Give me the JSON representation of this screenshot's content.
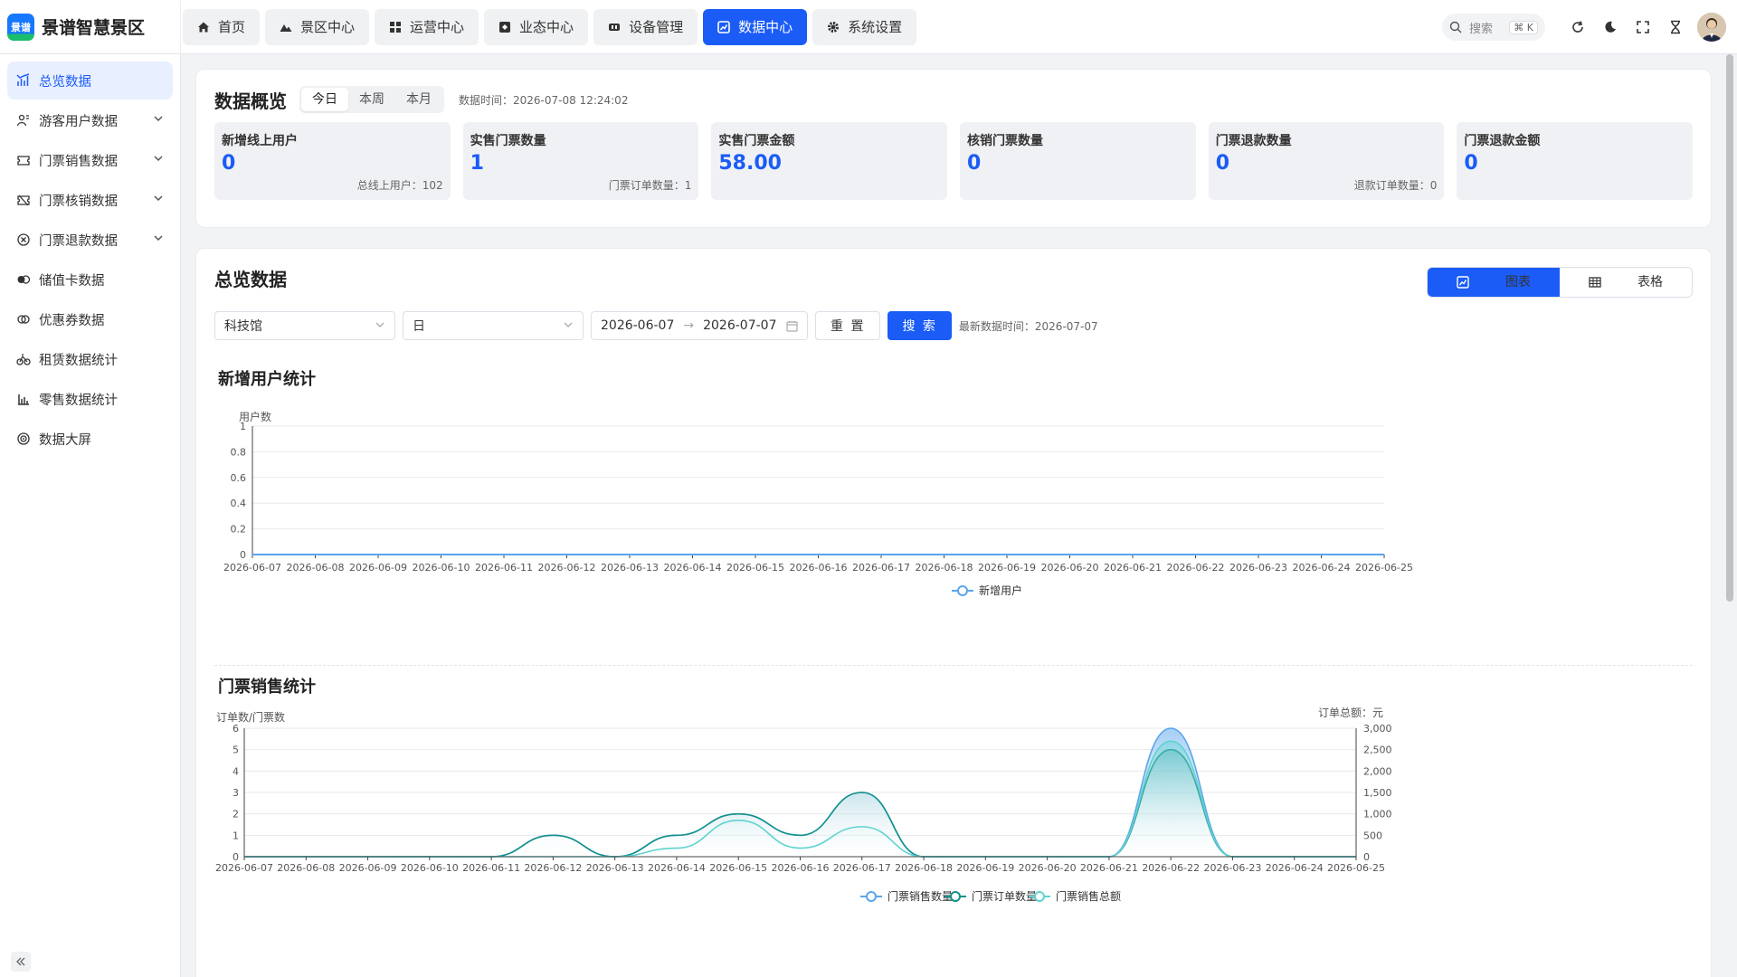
{
  "app": {
    "title": "景谱智慧景区",
    "logo_text": "景谱"
  },
  "topnav": [
    {
      "label": "首页",
      "icon": "home-icon",
      "active": false
    },
    {
      "label": "景区中心",
      "icon": "mountain-icon",
      "active": false
    },
    {
      "label": "运营中心",
      "icon": "grid-icon",
      "active": false
    },
    {
      "label": "业态中心",
      "icon": "store-icon",
      "active": false
    },
    {
      "label": "设备管理",
      "icon": "device-icon",
      "active": false
    },
    {
      "label": "数据中心",
      "icon": "chart-icon",
      "active": true
    },
    {
      "label": "系统设置",
      "icon": "gear-icon",
      "active": false
    }
  ],
  "header": {
    "search_placeholder": "搜索",
    "search_shortcut": "⌘ K"
  },
  "sidebar": {
    "items": [
      {
        "label": "总览数据",
        "icon": "bar-chart-icon",
        "active": true,
        "expandable": false
      },
      {
        "label": "游客用户数据",
        "icon": "users-icon",
        "active": false,
        "expandable": true
      },
      {
        "label": "门票销售数据",
        "icon": "ticket-icon",
        "active": false,
        "expandable": true
      },
      {
        "label": "门票核销数据",
        "icon": "ticket-check-icon",
        "active": false,
        "expandable": true
      },
      {
        "label": "门票退款数据",
        "icon": "refund-icon",
        "active": false,
        "expandable": true
      },
      {
        "label": "储值卡数据",
        "icon": "card-icon",
        "active": false,
        "expandable": false
      },
      {
        "label": "优惠券数据",
        "icon": "coupon-icon",
        "active": false,
        "expandable": false
      },
      {
        "label": "租赁数据统计",
        "icon": "rental-icon",
        "active": false,
        "expandable": false
      },
      {
        "label": "零售数据统计",
        "icon": "retail-icon",
        "active": false,
        "expandable": false
      },
      {
        "label": "数据大屏",
        "icon": "screen-icon",
        "active": false,
        "expandable": false
      }
    ]
  },
  "overview": {
    "title": "数据概览",
    "periods": [
      "今日",
      "本周",
      "本月"
    ],
    "active_period": "今日",
    "data_time": "数据时间：2026-07-08 12:24:02",
    "stats": [
      {
        "label": "新增线上用户",
        "value": "0",
        "sub": "总线上用户：102"
      },
      {
        "label": "实售门票数量",
        "value": "1",
        "sub": "门票订单数量：1"
      },
      {
        "label": "实售门票金额",
        "value": "58.00",
        "sub": ""
      },
      {
        "label": "核销门票数量",
        "value": "0",
        "sub": ""
      },
      {
        "label": "门票退款数量",
        "value": "0",
        "sub": "退款订单数量：0"
      },
      {
        "label": "门票退款金额",
        "value": "0",
        "sub": ""
      }
    ]
  },
  "panel": {
    "title": "总览数据",
    "view_chart": "图表",
    "view_table": "表格",
    "filters": {
      "venue": "科技馆",
      "granularity": "日",
      "date_start": "2026-06-07",
      "date_end": "2026-07-07",
      "reset": "重 置",
      "search": "搜 索",
      "latest": "最新数据时间：2026-07-07"
    }
  },
  "colors": {
    "primary": "#1b5cf7",
    "series_sales": "#5aa5ec",
    "series_orders": "#12918a",
    "series_amount": "#5fd3d0"
  },
  "chart_data": [
    {
      "type": "line",
      "title": "新增用户统计",
      "ylabel": "用户数",
      "ylim": [
        0,
        1
      ],
      "yticks": [
        "0",
        "0.2",
        "0.4",
        "0.6",
        "0.8",
        "1"
      ],
      "x": [
        "2026-06-07",
        "2026-06-08",
        "2026-06-09",
        "2026-06-10",
        "2026-06-11",
        "2026-06-12",
        "2026-06-13",
        "2026-06-14",
        "2026-06-15",
        "2026-06-16",
        "2026-06-17",
        "2026-06-18",
        "2026-06-19",
        "2026-06-20",
        "2026-06-21",
        "2026-06-22",
        "2026-06-23",
        "2026-06-24",
        "2026-06-25"
      ],
      "series": [
        {
          "name": "新增用户",
          "values": [
            0,
            0,
            0,
            0,
            0,
            0,
            0,
            0,
            0,
            0,
            0,
            0,
            0,
            0,
            0,
            0,
            0,
            0,
            0
          ]
        }
      ],
      "legend": "bottom-center"
    },
    {
      "type": "area",
      "title": "门票销售统计",
      "ylabel": "订单数/门票数",
      "ylabel_right": "订单总额：元",
      "ylim": [
        0,
        6
      ],
      "ylim_right": [
        0,
        3000
      ],
      "yticks": [
        "0",
        "1",
        "2",
        "3",
        "4",
        "5",
        "6"
      ],
      "yticks_right": [
        "0",
        "500",
        "1,000",
        "1,500",
        "2,000",
        "2,500",
        "3,000"
      ],
      "x": [
        "2026-06-07",
        "2026-06-08",
        "2026-06-09",
        "2026-06-10",
        "2026-06-11",
        "2026-06-12",
        "2026-06-13",
        "2026-06-14",
        "2026-06-15",
        "2026-06-16",
        "2026-06-17",
        "2026-06-18",
        "2026-06-19",
        "2026-06-20",
        "2026-06-21",
        "2026-06-22",
        "2026-06-23",
        "2026-06-24",
        "2026-06-25"
      ],
      "series": [
        {
          "name": "门票销售数量",
          "axis": "left",
          "values": [
            0,
            0,
            0,
            0,
            0,
            1,
            0,
            1,
            2,
            1,
            3,
            0,
            0,
            0,
            0,
            6,
            0,
            0,
            0
          ]
        },
        {
          "name": "门票订单数量",
          "axis": "left",
          "values": [
            0,
            0,
            0,
            0,
            0,
            1,
            0,
            1,
            2,
            1,
            3,
            0,
            0,
            0,
            0,
            5,
            0,
            0,
            0
          ]
        },
        {
          "name": "门票销售总额",
          "axis": "right",
          "values": [
            0,
            0,
            0,
            0,
            0,
            0,
            0,
            200,
            850,
            200,
            700,
            0,
            0,
            0,
            0,
            2700,
            0,
            0,
            0
          ]
        }
      ],
      "legend": "bottom-center"
    }
  ]
}
